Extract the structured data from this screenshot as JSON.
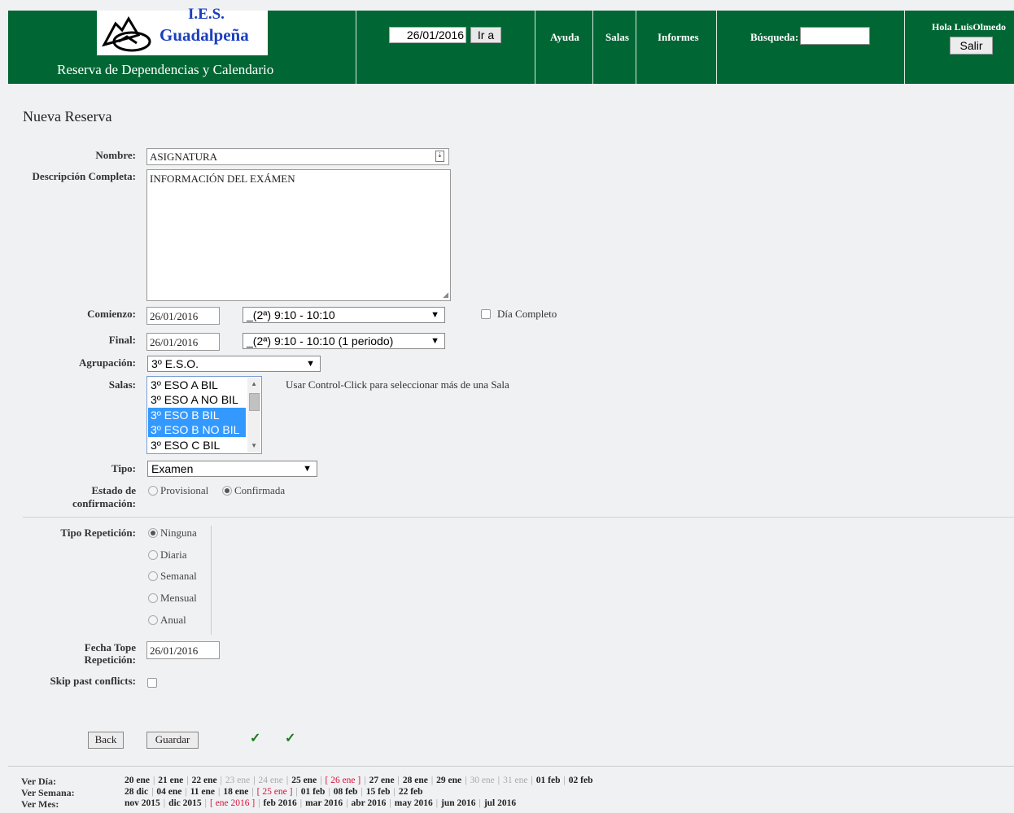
{
  "header": {
    "logo_ies": "I.E.S.",
    "logo_name": "Guadalpeña",
    "tagline": "Reserva de Dependencias y Calendario",
    "date_value": "26/01/2016",
    "go_label": "Ir a",
    "nav": [
      "Ayuda",
      "Salas",
      "Informes"
    ],
    "search_label": "Búsqueda:",
    "search_value": "",
    "greeting": "Hola LuisOlmedo",
    "logout_label": "Salir"
  },
  "form": {
    "title": "Nueva Reserva",
    "name_label": "Nombre:",
    "name_value": "ASIGNATURA",
    "desc_label": "Descripción Completa:",
    "desc_value": "INFORMACIÓN DEL EXÁMEN",
    "start_label": "Comienzo:",
    "start_date": "26/01/2016",
    "start_period": "_(2ª) 9:10 - 10:10",
    "allday_label": "Día Completo",
    "end_label": "Final:",
    "end_date": "26/01/2016",
    "end_period": "_(2ª) 9:10 - 10:10  (1 periodo)",
    "group_label": "Agrupación:",
    "group_value": "3º E.S.O.",
    "rooms_label": "Salas:",
    "rooms": [
      {
        "label": "3º ESO A BIL",
        "selected": false
      },
      {
        "label": "3º ESO A NO BIL",
        "selected": false
      },
      {
        "label": "3º ESO B BIL",
        "selected": true
      },
      {
        "label": "3º ESO B NO BIL",
        "selected": true
      },
      {
        "label": "3º ESO C BIL",
        "selected": false
      }
    ],
    "rooms_hint": "Usar Control-Click para seleccionar más de una Sala",
    "type_label": "Tipo:",
    "type_value": "Examen",
    "status_label_1": "Estado de",
    "status_label_2": "confirmación:",
    "status_options": [
      "Provisional",
      "Confirmada"
    ],
    "status_selected": "Confirmada",
    "repeat_label": "Tipo Repetición:",
    "repeat_options": [
      "Ninguna",
      "Diaria",
      "Semanal",
      "Mensual",
      "Anual"
    ],
    "repeat_selected": "Ninguna",
    "repeat_end_label_1": "Fecha Tope",
    "repeat_end_label_2": "Repetición:",
    "repeat_end_value": "26/01/2016",
    "skip_label": "Skip past conflicts:",
    "back_label": "Back",
    "save_label": "Guardar",
    "check_1": "✓",
    "check_2": "✓"
  },
  "footer": {
    "day_label": "Ver Día:",
    "week_label": "Ver Semana:",
    "month_label": "Ver Mes:",
    "days": [
      {
        "t": "20 ene",
        "s": "item"
      },
      {
        "t": "21 ene",
        "s": "item"
      },
      {
        "t": "22 ene",
        "s": "item"
      },
      {
        "t": "23 ene",
        "s": "muted"
      },
      {
        "t": "24 ene",
        "s": "muted"
      },
      {
        "t": "25 ene",
        "s": "item"
      },
      {
        "t": "[ 26 ene ]",
        "s": "cur"
      },
      {
        "t": "27 ene",
        "s": "item"
      },
      {
        "t": "28 ene",
        "s": "item"
      },
      {
        "t": "29 ene",
        "s": "item"
      },
      {
        "t": "30 ene",
        "s": "muted"
      },
      {
        "t": "31 ene",
        "s": "muted"
      },
      {
        "t": "01 feb",
        "s": "item"
      },
      {
        "t": "02 feb",
        "s": "item"
      }
    ],
    "weeks": [
      {
        "t": "28 dic",
        "s": "item"
      },
      {
        "t": "04 ene",
        "s": "item"
      },
      {
        "t": "11 ene",
        "s": "item"
      },
      {
        "t": "18 ene",
        "s": "item"
      },
      {
        "t": "[ 25 ene ]",
        "s": "cur"
      },
      {
        "t": "01 feb",
        "s": "item"
      },
      {
        "t": "08 feb",
        "s": "item"
      },
      {
        "t": "15 feb",
        "s": "item"
      },
      {
        "t": "22 feb",
        "s": "item"
      }
    ],
    "months": [
      {
        "t": "nov 2015",
        "s": "item"
      },
      {
        "t": "dic 2015",
        "s": "item"
      },
      {
        "t": "[ ene 2016 ]",
        "s": "cur"
      },
      {
        "t": "feb 2016",
        "s": "item"
      },
      {
        "t": "mar 2016",
        "s": "item"
      },
      {
        "t": "abr 2016",
        "s": "item"
      },
      {
        "t": "may 2016",
        "s": "item"
      },
      {
        "t": "jun 2016",
        "s": "item"
      },
      {
        "t": "jul 2016",
        "s": "item"
      }
    ]
  },
  "colors": {
    "header_bg": "#006633",
    "selected_option": "#3399ff",
    "current_link": "#d6133b",
    "check": "#1a7a1a"
  }
}
